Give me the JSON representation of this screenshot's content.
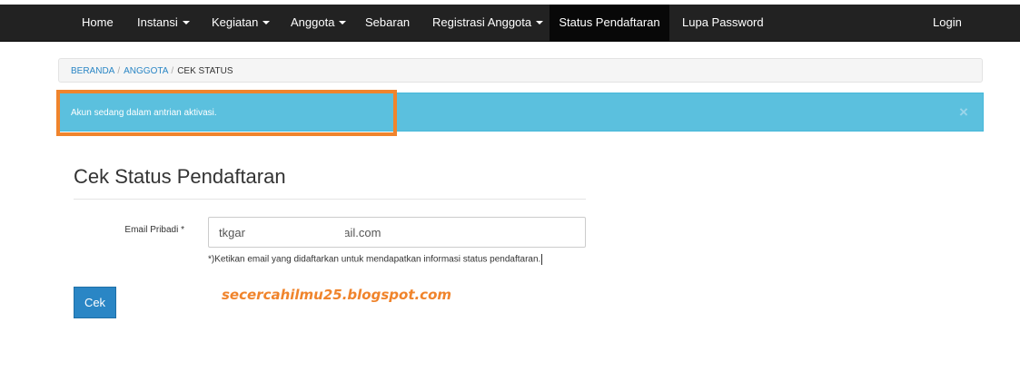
{
  "nav": {
    "home": "Home",
    "instansi": "Instansi",
    "kegiatan": "Kegiatan",
    "anggota": "Anggota",
    "sebaran": "Sebaran",
    "registrasi": "Registrasi Anggota",
    "status": "Status Pendaftaran",
    "lupa_password": "Lupa Password",
    "login": "Login"
  },
  "breadcrumb": {
    "beranda": "BERANDA",
    "anggota": "ANGGOTA",
    "current": "CEK STATUS",
    "separator": "/"
  },
  "alert": {
    "message": "Akun sedang dalam antrian aktivasi.",
    "close_symbol": "×"
  },
  "form": {
    "title": "Cek Status Pendaftaran",
    "email_label": "Email Pribadi *",
    "email_value": "tkgar                              ail.com",
    "help_text": "*)Ketikan email yang didaftarkan untuk mendapatkan informasi status pendaftaran.",
    "submit_label": "Cek"
  },
  "watermark": "secercahilmu25.blogspot.com",
  "colors": {
    "navbar": "#222222",
    "active_nav": "#080808",
    "alert_bg": "#5bc0de",
    "primary": "#2a86c5",
    "highlight": "#f0842c"
  }
}
